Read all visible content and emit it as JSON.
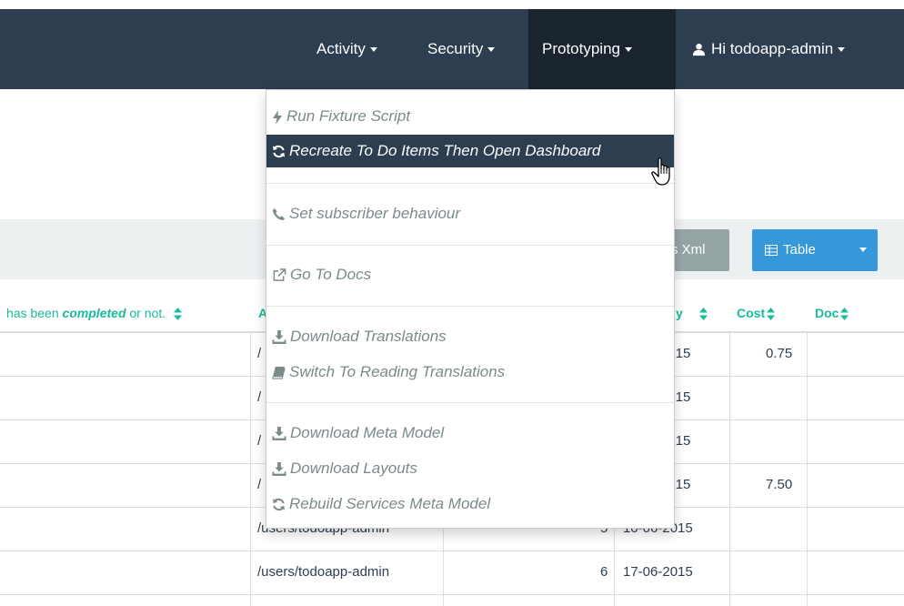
{
  "navbar": {
    "items": [
      {
        "label": "Activity"
      },
      {
        "label": "Security"
      },
      {
        "label": "Prototyping"
      },
      {
        "label": "Hi todoapp-admin"
      }
    ]
  },
  "dropdown": {
    "items": [
      {
        "label": "Run Fixture Script",
        "icon": "bolt-icon"
      },
      {
        "label": "Recreate To Do Items Then Open Dashboard",
        "icon": "refresh-icon"
      },
      {
        "label": "Set subscriber behaviour",
        "icon": "phone-icon"
      },
      {
        "label": "Go To Docs",
        "icon": "external-link-icon"
      },
      {
        "label": "Download Translations",
        "icon": "download-icon"
      },
      {
        "label": "Switch To Reading Translations",
        "icon": "book-icon"
      },
      {
        "label": "Download Meta Model",
        "icon": "download-icon"
      },
      {
        "label": "Download Layouts",
        "icon": "download-icon"
      },
      {
        "label": "Rebuild Services Meta Model",
        "icon": "refresh-icon"
      }
    ]
  },
  "toolbar": {
    "xml_label": "s Xml",
    "table_label": "Table"
  },
  "table": {
    "headers": {
      "complete_prefix": "has been ",
      "complete_em": "completed",
      "complete_suffix": " or not.",
      "atpath": "A",
      "duedate": "y",
      "cost": "Cost",
      "doc": "Doc"
    },
    "rows": [
      {
        "atpath": "/",
        "seq": "",
        "date": "-2015",
        "cost": "0.75"
      },
      {
        "atpath": "/",
        "seq": "",
        "date": "-2015",
        "cost": ""
      },
      {
        "atpath": "/",
        "seq": "",
        "date": "-2015",
        "cost": ""
      },
      {
        "atpath": "/",
        "seq": "",
        "date": "-2015",
        "cost": "7.50"
      },
      {
        "atpath": "/users/todoapp-admin",
        "seq": "5",
        "date": "10-06-2015",
        "cost": ""
      },
      {
        "atpath": "/users/todoapp-admin",
        "seq": "6",
        "date": "17-06-2015",
        "cost": ""
      }
    ]
  }
}
